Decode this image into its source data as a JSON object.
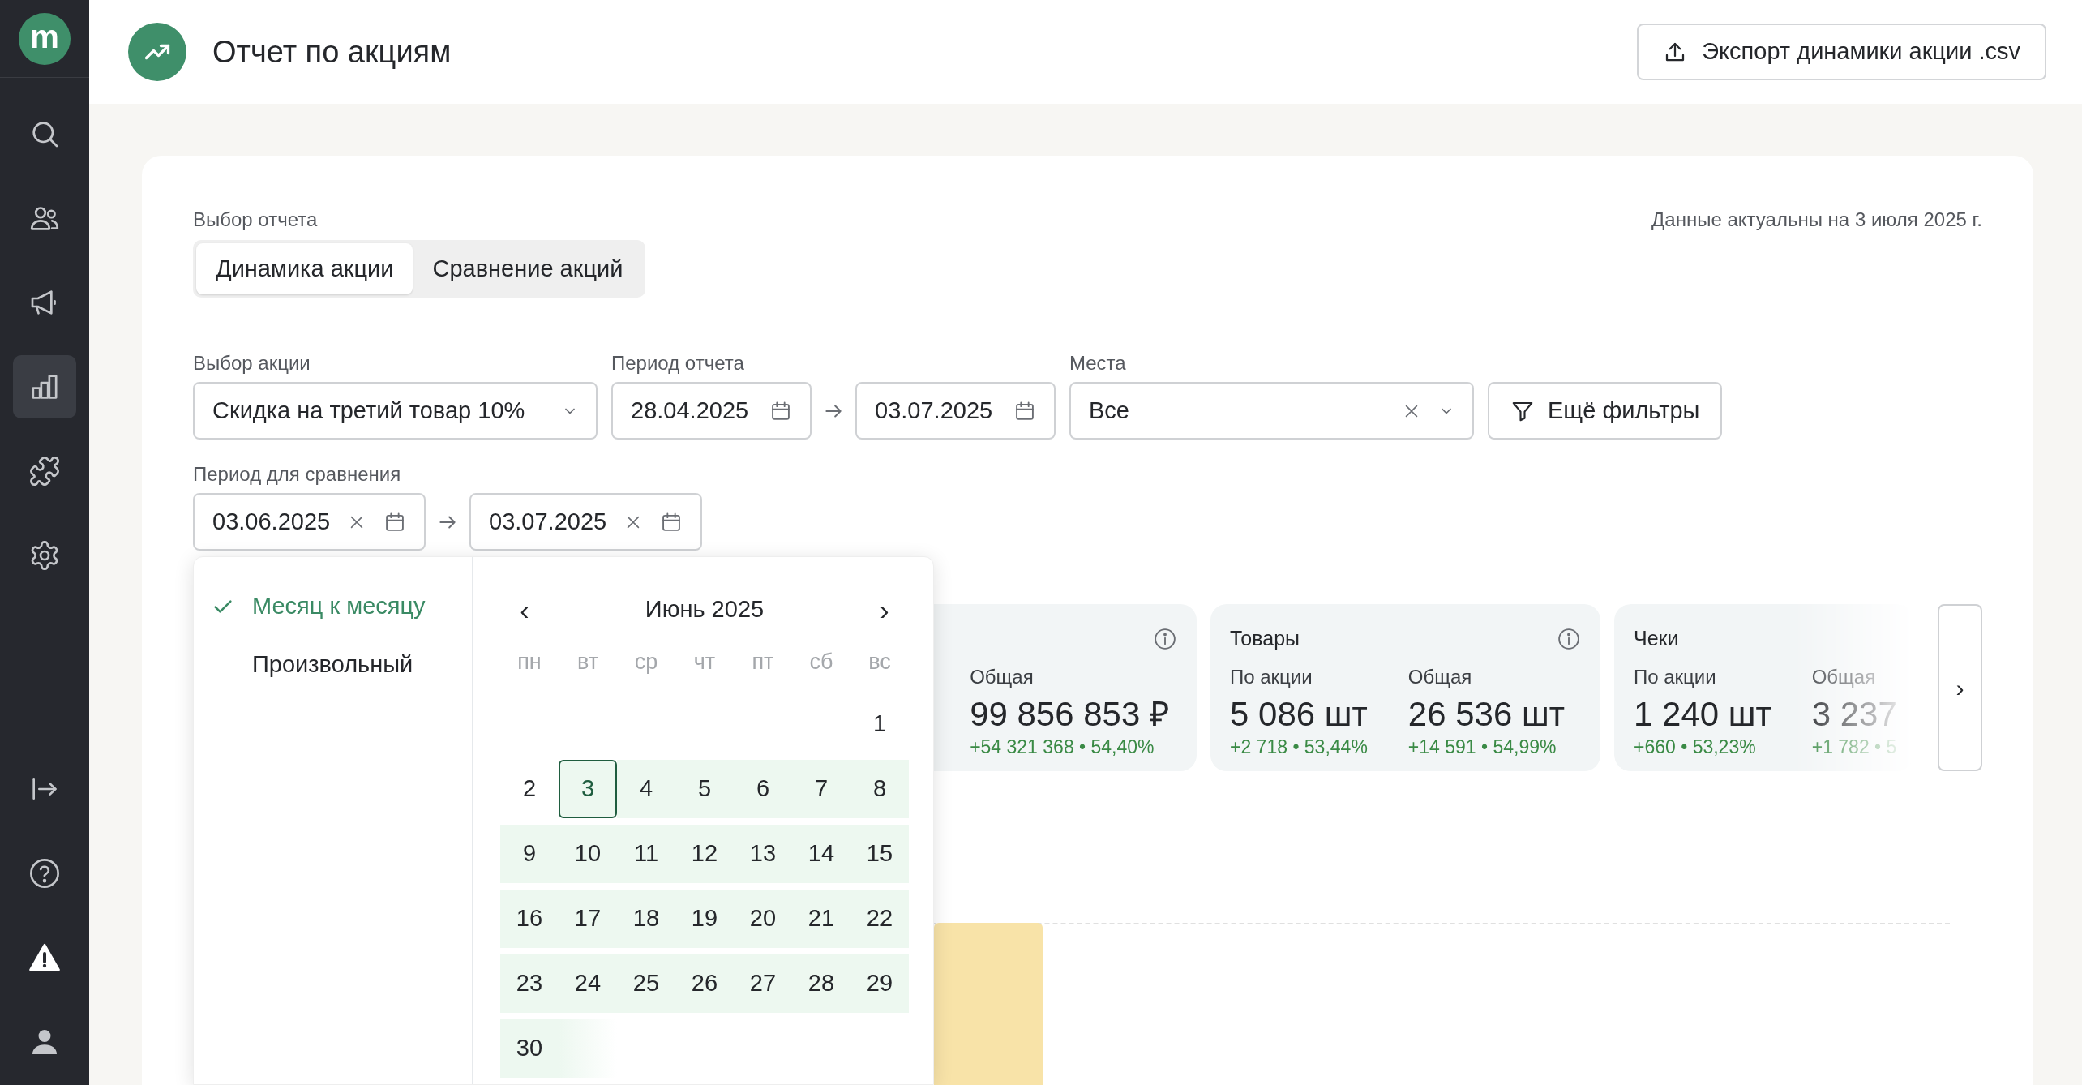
{
  "sidebar": {
    "logo": "m",
    "items": [
      {
        "kind": "search",
        "selected": false
      },
      {
        "kind": "users",
        "selected": false
      },
      {
        "kind": "megaphone",
        "selected": false
      },
      {
        "kind": "chart",
        "selected": true
      },
      {
        "kind": "puzzle",
        "selected": false
      },
      {
        "kind": "settings",
        "selected": false
      }
    ],
    "bottom_items": [
      {
        "kind": "logout",
        "selected": false
      },
      {
        "kind": "help",
        "selected": false
      },
      {
        "kind": "warning",
        "selected": false
      },
      {
        "kind": "profile",
        "selected": false
      }
    ]
  },
  "header": {
    "title": "Отчет по акциям",
    "export_button": "Экспорт динамики акции .csv"
  },
  "report": {
    "label": "Выбор отчета",
    "tabs": [
      {
        "label": "Динамика акции",
        "selected": true
      },
      {
        "label": "Сравнение акций",
        "selected": false
      }
    ],
    "updated": "Данные актуальны на 3 июля 2025 г."
  },
  "filters": {
    "promo": {
      "label": "Выбор акции",
      "value": "Скидка на третий товар 10%"
    },
    "period": {
      "label": "Период отчета",
      "from": "28.04.2025",
      "to": "03.07.2025"
    },
    "places": {
      "label": "Места",
      "value": "Все"
    },
    "more_filters": "Ещё фильтры",
    "comparison": {
      "label": "Период для сравнения",
      "from": "03.06.2025",
      "to": "03.07.2025"
    }
  },
  "popup": {
    "presets": [
      {
        "label": "Месяц к месяцу",
        "selected": true
      },
      {
        "label": "Произвольный",
        "selected": false
      }
    ],
    "calendar": {
      "month": "Июнь 2025",
      "prev": "‹",
      "next": "›",
      "weekdays": [
        "пн",
        "вт",
        "ср",
        "чт",
        "пт",
        "сб",
        "вс"
      ],
      "weeks": [
        [
          {
            "label": "1",
            "in_range": false,
            "selected": false
          }
        ],
        [
          {
            "label": "2",
            "in_range": false,
            "selected": false
          },
          {
            "label": "3",
            "in_range": true,
            "selected": true
          },
          {
            "label": "4",
            "in_range": true,
            "selected": false
          },
          {
            "label": "5",
            "in_range": true,
            "selected": false
          },
          {
            "label": "6",
            "in_range": true,
            "selected": false
          },
          {
            "label": "7",
            "in_range": true,
            "selected": false
          },
          {
            "label": "8",
            "in_range": true,
            "selected": false
          }
        ],
        [
          {
            "label": "9",
            "in_range": true,
            "selected": false
          },
          {
            "label": "10",
            "in_range": true,
            "selected": false
          },
          {
            "label": "11",
            "in_range": true,
            "selected": false
          },
          {
            "label": "12",
            "in_range": true,
            "selected": false
          },
          {
            "label": "13",
            "in_range": true,
            "selected": false
          },
          {
            "label": "14",
            "in_range": true,
            "selected": false
          },
          {
            "label": "15",
            "in_range": true,
            "selected": false
          }
        ],
        [
          {
            "label": "16",
            "in_range": true,
            "selected": false
          },
          {
            "label": "17",
            "in_range": true,
            "selected": false
          },
          {
            "label": "18",
            "in_range": true,
            "selected": false
          },
          {
            "label": "19",
            "in_range": true,
            "selected": false
          },
          {
            "label": "20",
            "in_range": true,
            "selected": false
          },
          {
            "label": "21",
            "in_range": true,
            "selected": false
          },
          {
            "label": "22",
            "in_range": true,
            "selected": false
          }
        ],
        [
          {
            "label": "23",
            "in_range": true,
            "selected": false
          },
          {
            "label": "24",
            "in_range": true,
            "selected": false
          },
          {
            "label": "25",
            "in_range": true,
            "selected": false
          },
          {
            "label": "26",
            "in_range": true,
            "selected": false
          },
          {
            "label": "27",
            "in_range": true,
            "selected": false
          },
          {
            "label": "28",
            "in_range": true,
            "selected": false
          },
          {
            "label": "29",
            "in_range": true,
            "selected": false
          }
        ],
        [
          {
            "label": "30",
            "in_range": true,
            "selected": false
          }
        ]
      ]
    }
  },
  "cards": [
    {
      "info_icon": true,
      "metrics": [
        {
          "label": "Общая",
          "value": "99 856 853 ₽",
          "delta": "+54 321 368 • 54,40%"
        }
      ]
    },
    {
      "title": "Товары",
      "info_icon": true,
      "metrics": [
        {
          "label": "По акции",
          "value": "5 086 шт",
          "delta": "+2 718 • 53,44%"
        },
        {
          "label": "Общая",
          "value": "26 536 шт",
          "delta": "+14 591 • 54,99%"
        }
      ]
    },
    {
      "title": "Чеки",
      "info_icon": false,
      "faded": true,
      "metrics": [
        {
          "label": "По акции",
          "value": "1 240 шт",
          "delta": "+660 • 53,23%"
        },
        {
          "label": "Общая",
          "value": "3 237",
          "delta": "+1 782 • 5"
        }
      ]
    }
  ],
  "next_button": "›"
}
